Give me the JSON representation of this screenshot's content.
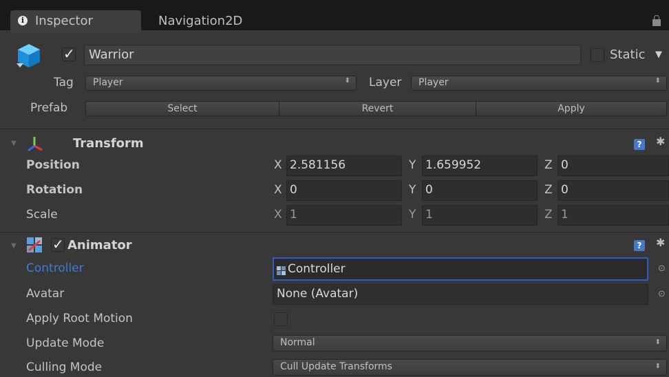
{
  "tabs": {
    "inspector": "Inspector",
    "navigation": "Navigation2D"
  },
  "object": {
    "name": "Warrior",
    "static_label": "Static",
    "tag_label": "Tag",
    "tag_value": "Player",
    "layer_label": "Layer",
    "layer_value": "Player"
  },
  "prefab": {
    "label": "Prefab",
    "select": "Select",
    "revert": "Revert",
    "apply": "Apply"
  },
  "transform": {
    "title": "Transform",
    "position_label": "Position",
    "rotation_label": "Rotation",
    "scale_label": "Scale",
    "axes": {
      "x": "X",
      "y": "Y",
      "z": "Z"
    },
    "position": {
      "x": "2.581156",
      "y": "1.659952",
      "z": "0"
    },
    "rotation": {
      "x": "0",
      "y": "0",
      "z": "0"
    },
    "scale": {
      "x": "1",
      "y": "1",
      "z": "1"
    }
  },
  "animator": {
    "title": "Animator",
    "controller_label": "Controller",
    "controller_value": "Controller",
    "avatar_label": "Avatar",
    "avatar_value": "None (Avatar)",
    "root_motion_label": "Apply Root Motion",
    "update_mode_label": "Update Mode",
    "update_mode_value": "Normal",
    "culling_mode_label": "Culling Mode",
    "culling_mode_value": "Cull Update Transforms"
  },
  "glyphs": {
    "info": "i",
    "help": "?",
    "gear": "✱",
    "target": "⊙",
    "fold": "▼",
    "select_arrow": "⬍",
    "static_arrow": "▼"
  },
  "colors": {
    "background": "#383838",
    "topbar": "#191919",
    "highlight_label": "#3f7bd6",
    "focus_border": "#2e5fbf"
  }
}
